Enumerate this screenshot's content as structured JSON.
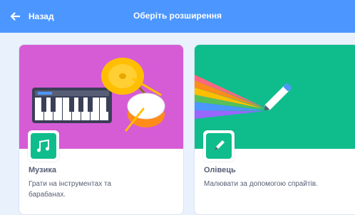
{
  "header": {
    "back_label": "Назад",
    "title": "Оберіть розширення",
    "color": "#4c97ff"
  },
  "extensions": [
    {
      "title": "Музика",
      "description": "Грати на інструментах та барабанах.",
      "icon": "music-notes-icon",
      "banner_color": "#d65cd6"
    },
    {
      "title": "Олівець",
      "description": "Малювати за допомогою спрайтів.",
      "icon": "pen-icon",
      "banner_color": "#0fbd8c"
    }
  ]
}
